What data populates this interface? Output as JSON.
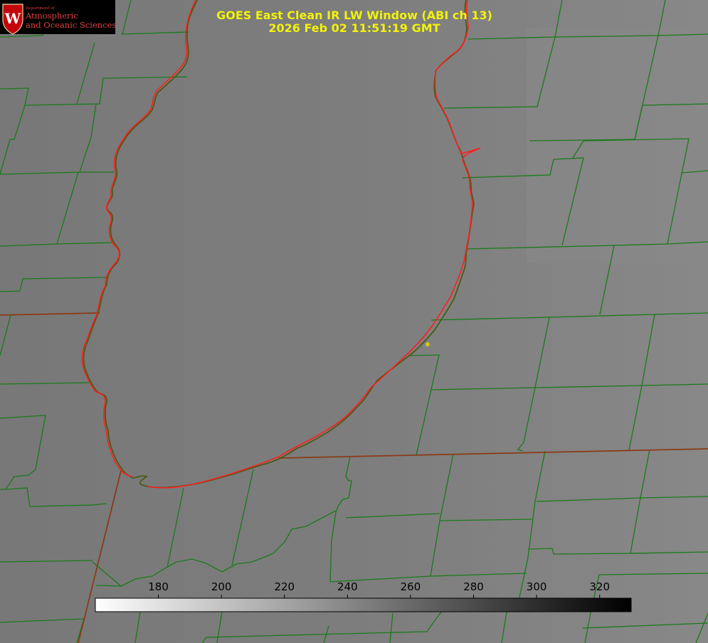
{
  "title": {
    "line1": "GOES East Clean IR LW Window (ABI ch 13)",
    "line2": "2026 Feb 02 11:51:19 GMT"
  },
  "logo": {
    "small": "Department of",
    "line1": "Atmospheric",
    "line2": "and Oceanic Sciences",
    "seal_letter": "W"
  },
  "colorbar": {
    "ticks": [
      "180",
      "200",
      "220",
      "240",
      "260",
      "280",
      "300",
      "320"
    ],
    "range": [
      160,
      330
    ],
    "colors": {
      "low": "#ffffff",
      "high": "#000000"
    }
  },
  "colors": {
    "background": "#7c7c7c",
    "county_lines": "#1a7a1a",
    "shoreline": "#ff1e1e",
    "title_text": "#f2f20a",
    "marker": "#d4c21a"
  },
  "marker": {
    "icon": "location-dot-icon"
  }
}
